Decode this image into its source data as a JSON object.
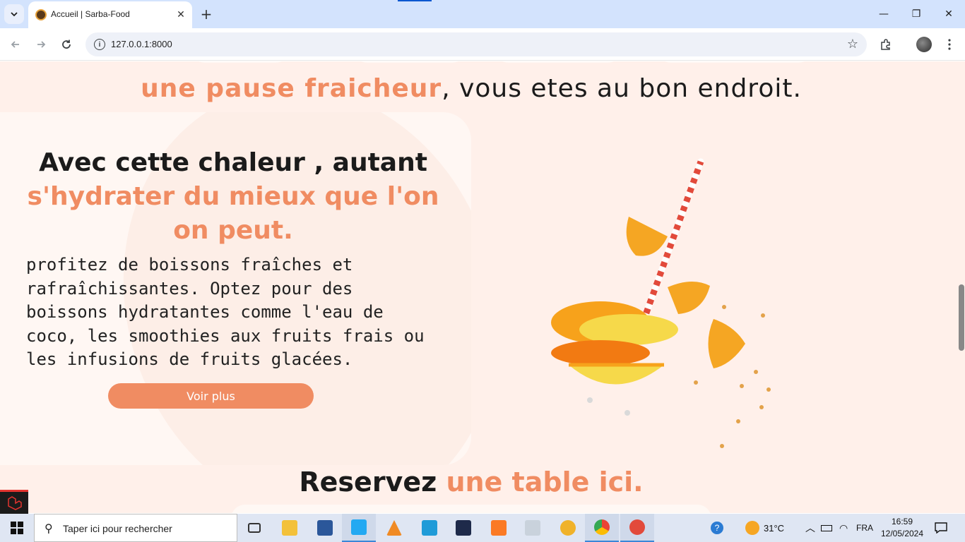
{
  "browser": {
    "tab_title": "Accueil | Sarba-Food",
    "tab_close": "✕",
    "new_tab": "+",
    "url": "127.0.0.1:8000",
    "window_controls": {
      "minimize": "—",
      "restore": "❐",
      "close": "✕"
    }
  },
  "page": {
    "hero_prefix_accent": "une pause fraicheur",
    "hero_suffix": ", vous etes au bon endroit.",
    "card_heading_line1": "Avec cette chaleur , autant",
    "card_heading_line2": "s'hydrater du mieux que l'on",
    "card_heading_line3": "on peut.",
    "card_body": "profitez de boissons fraîches et rafraîchissantes. Optez pour des boissons hydratantes comme l'eau de coco, les smoothies aux fruits frais ou les infusions de fruits glacées.",
    "cta_label": "Voir plus",
    "reserve_prefix": "Reservez ",
    "reserve_accent": "une table ici.",
    "colors": {
      "accent": "#f08c62",
      "background": "#fff0ea",
      "text": "#1b1b1b"
    }
  },
  "taskbar": {
    "search_placeholder": "Taper ici pour rechercher",
    "weather": "31°C",
    "language": "FRA",
    "time": "16:59",
    "date": "12/05/2024"
  }
}
